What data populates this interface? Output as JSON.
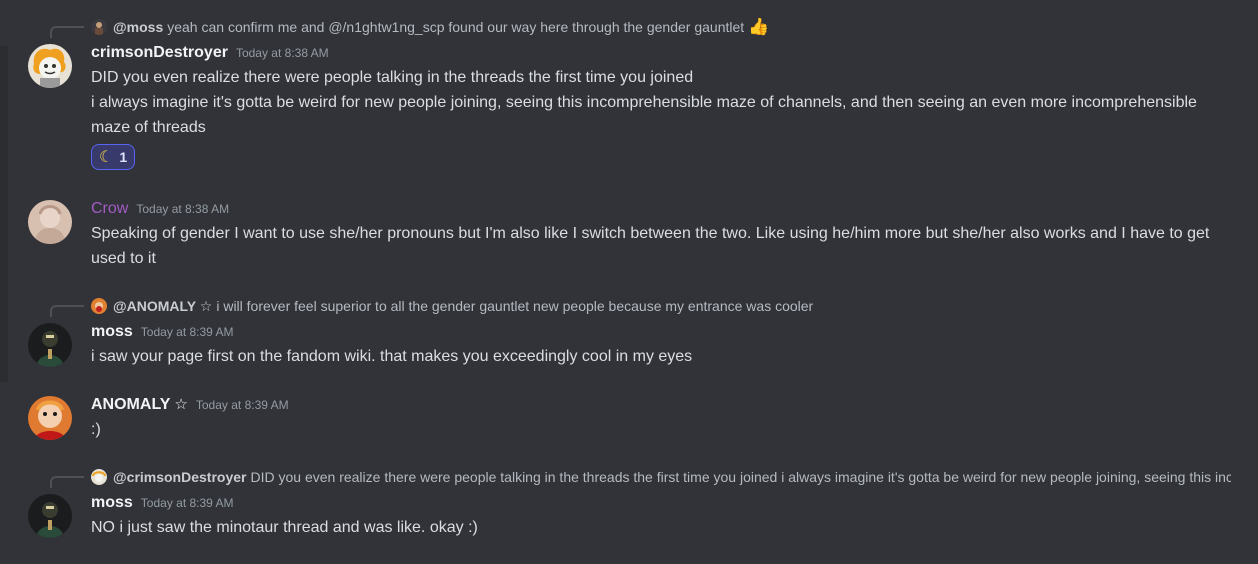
{
  "messages": [
    {
      "reply": {
        "author": "@moss",
        "text": "yeah can confirm me and @/n1ghtw1ng_scp found our way here through the gender gauntlet",
        "emoji": "👍"
      },
      "author": "crimsonDestroyer",
      "timestamp": "Today at 8:38 AM",
      "lines": [
        "DID you even realize there were people talking in the threads the first time you joined",
        "i always imagine it's gotta be weird for new people joining, seeing this incomprehensible maze of channels, and then seeing an even more incomprehensible maze of threads"
      ],
      "reaction": {
        "emoji": "☾",
        "count": "1"
      }
    },
    {
      "author": "Crow",
      "timestamp": "Today at 8:38 AM",
      "lines": [
        "Speaking of gender I want to use she/her pronouns but I'm also like I switch between the two. Like using he/him more but she/her also works and I have to get used to it"
      ]
    },
    {
      "reply": {
        "author": "@ANOMALY ☆",
        "text": "i will forever feel superior to all the gender gauntlet new people because my entrance was cooler"
      },
      "author": "moss",
      "timestamp": "Today at 8:39 AM",
      "lines": [
        "i saw your page first on the fandom wiki. that makes you exceedingly cool in my eyes"
      ]
    },
    {
      "author": "ANOMALY",
      "author_suffix": "☆",
      "timestamp": "Today at 8:39 AM",
      "lines": [
        ":)"
      ]
    },
    {
      "reply": {
        "author": "@crimsonDestroyer",
        "text": "DID you even realize there were people talking in the threads the first time you joined i always imagine it's gotta be weird for new people joining, seeing this incomprehensible maze of channels, and then seeing an even more incomprehensible maze of threads"
      },
      "author": "moss",
      "timestamp": "Today at 8:39 AM",
      "lines": [
        "NO i just saw the minotaur thread and was like. okay :)"
      ]
    }
  ],
  "colors": {
    "background": "#313338",
    "text": "#dbdee1",
    "username": "#f2f3f5",
    "crow_username": "#a25bc4",
    "timestamp": "#949ba4",
    "reaction_border": "#5865f2",
    "reaction_bg": "#373a6b"
  }
}
